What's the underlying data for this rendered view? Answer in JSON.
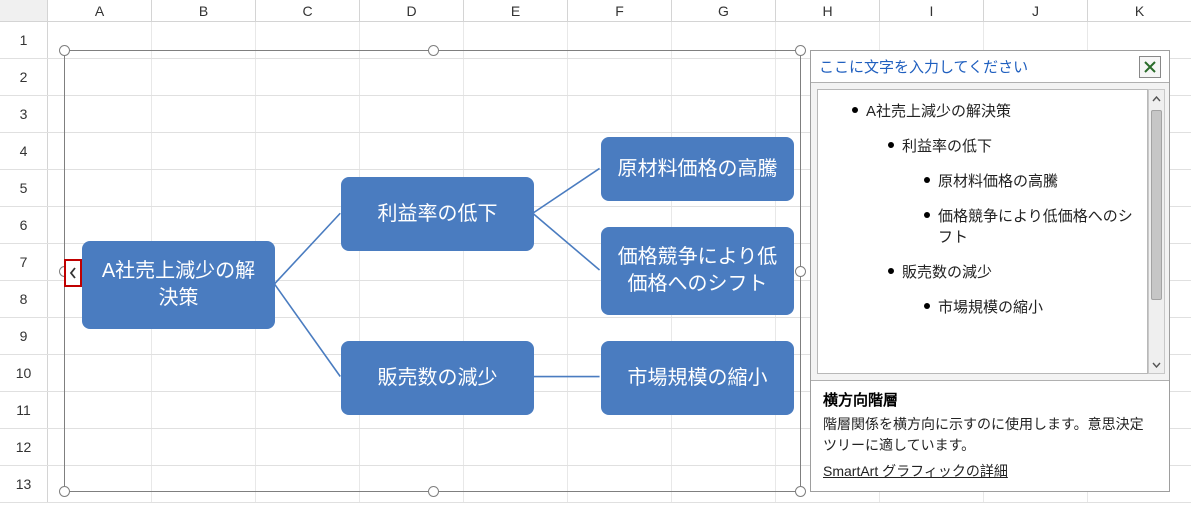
{
  "grid": {
    "columns": [
      "A",
      "B",
      "C",
      "D",
      "E",
      "F",
      "G",
      "H",
      "I",
      "J",
      "K"
    ],
    "rows": [
      "1",
      "2",
      "3",
      "4",
      "5",
      "6",
      "7",
      "8",
      "9",
      "10",
      "11",
      "12",
      "13"
    ]
  },
  "smartart": {
    "root": "A社売上減少の解決策",
    "level2a": "利益率の低下",
    "level2b": "販売数の減少",
    "level3a": "原材料価格の高騰",
    "level3b": "価格競争により低価格へのシフト",
    "level3c": "市場規模の縮小"
  },
  "pane": {
    "title": "ここに文字を入力してください",
    "outline": {
      "i1": "A社売上減少の解決策",
      "i2": "利益率の低下",
      "i3": "原材料価格の高騰",
      "i4": "価格競争により低価格へのシフト",
      "i5": "販売数の減少",
      "i6": "市場規模の縮小"
    },
    "layout_title": "横方向階層",
    "layout_desc": "階層関係を横方向に示すのに使用します。意思決定ツリーに適しています。",
    "layout_link": "SmartArt グラフィックの詳細"
  }
}
